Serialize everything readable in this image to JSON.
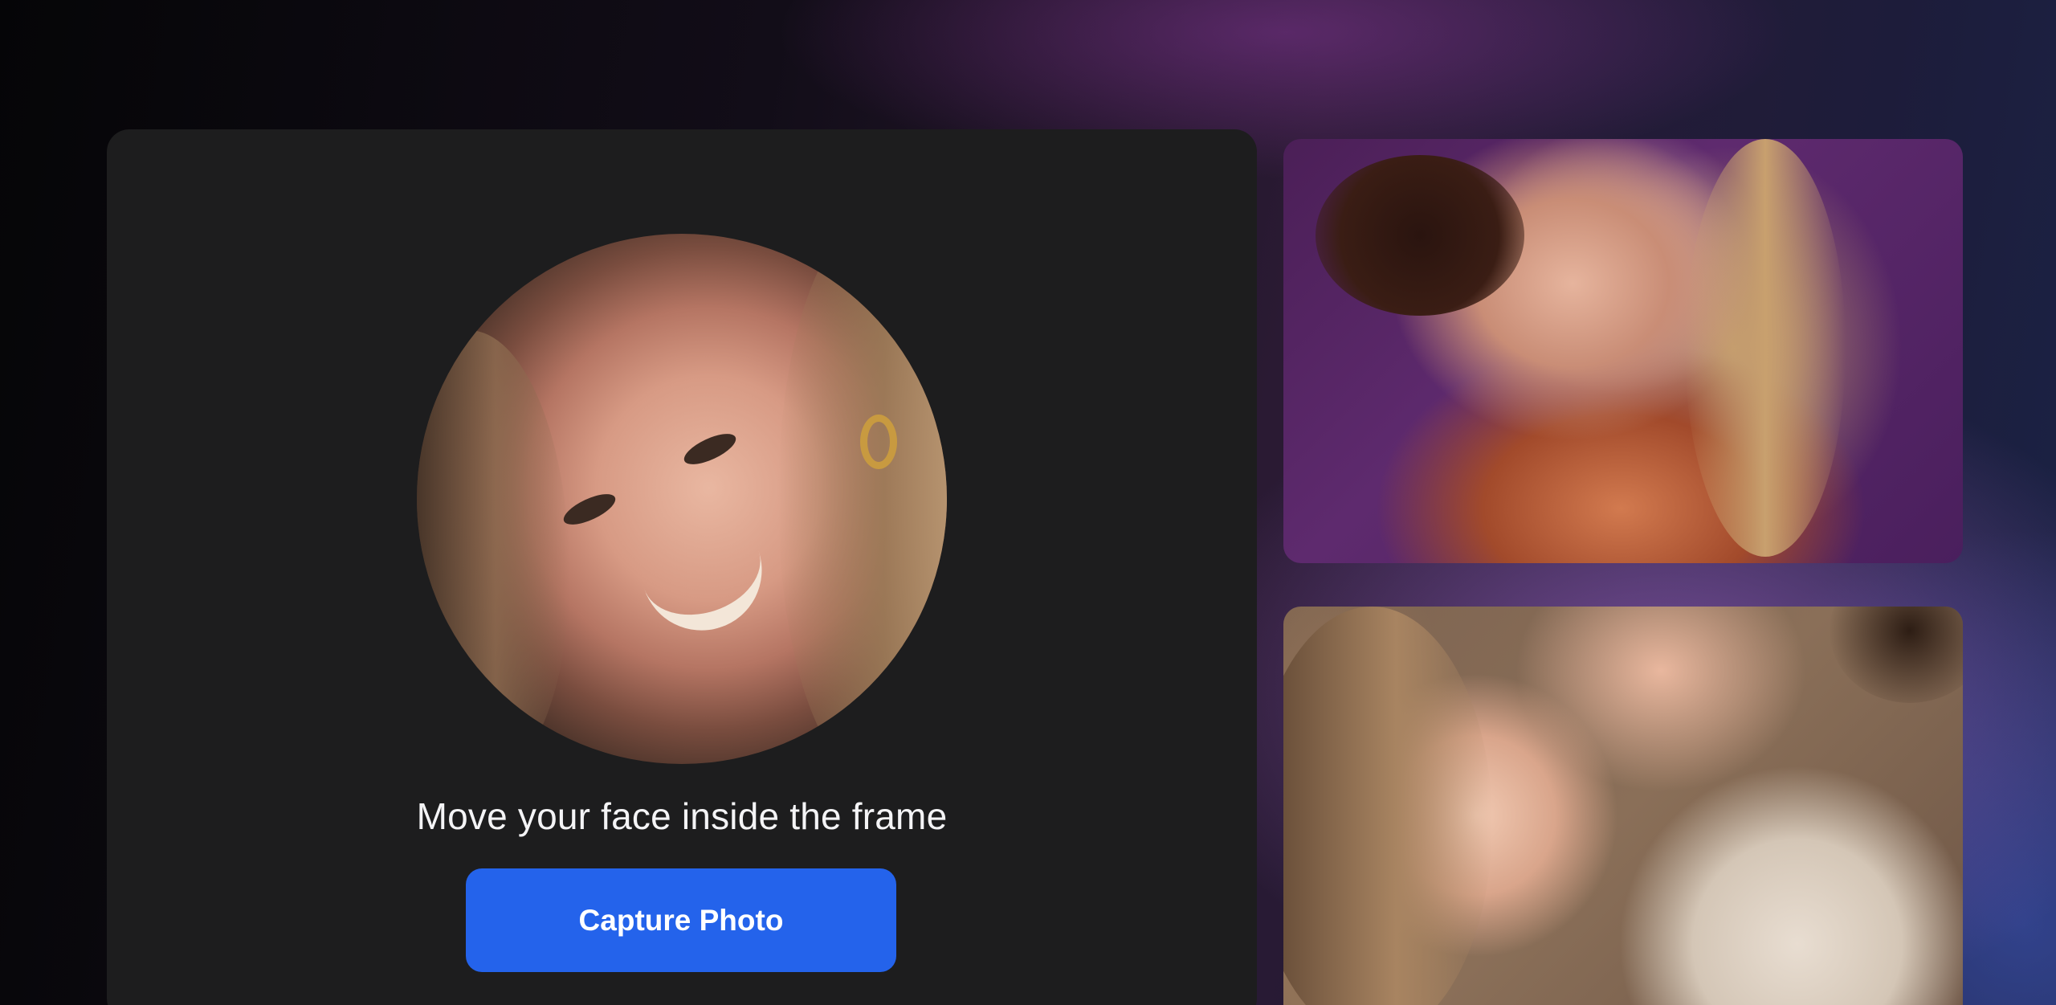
{
  "camera": {
    "prompt": "Move your face inside the frame",
    "capture_label": "Capture Photo"
  },
  "colors": {
    "panel": "#1d1d1e",
    "button": "#2463eb",
    "prompt_text": "#f4f4f6"
  },
  "icons": {
    "face_preview": "face-preview-image"
  }
}
